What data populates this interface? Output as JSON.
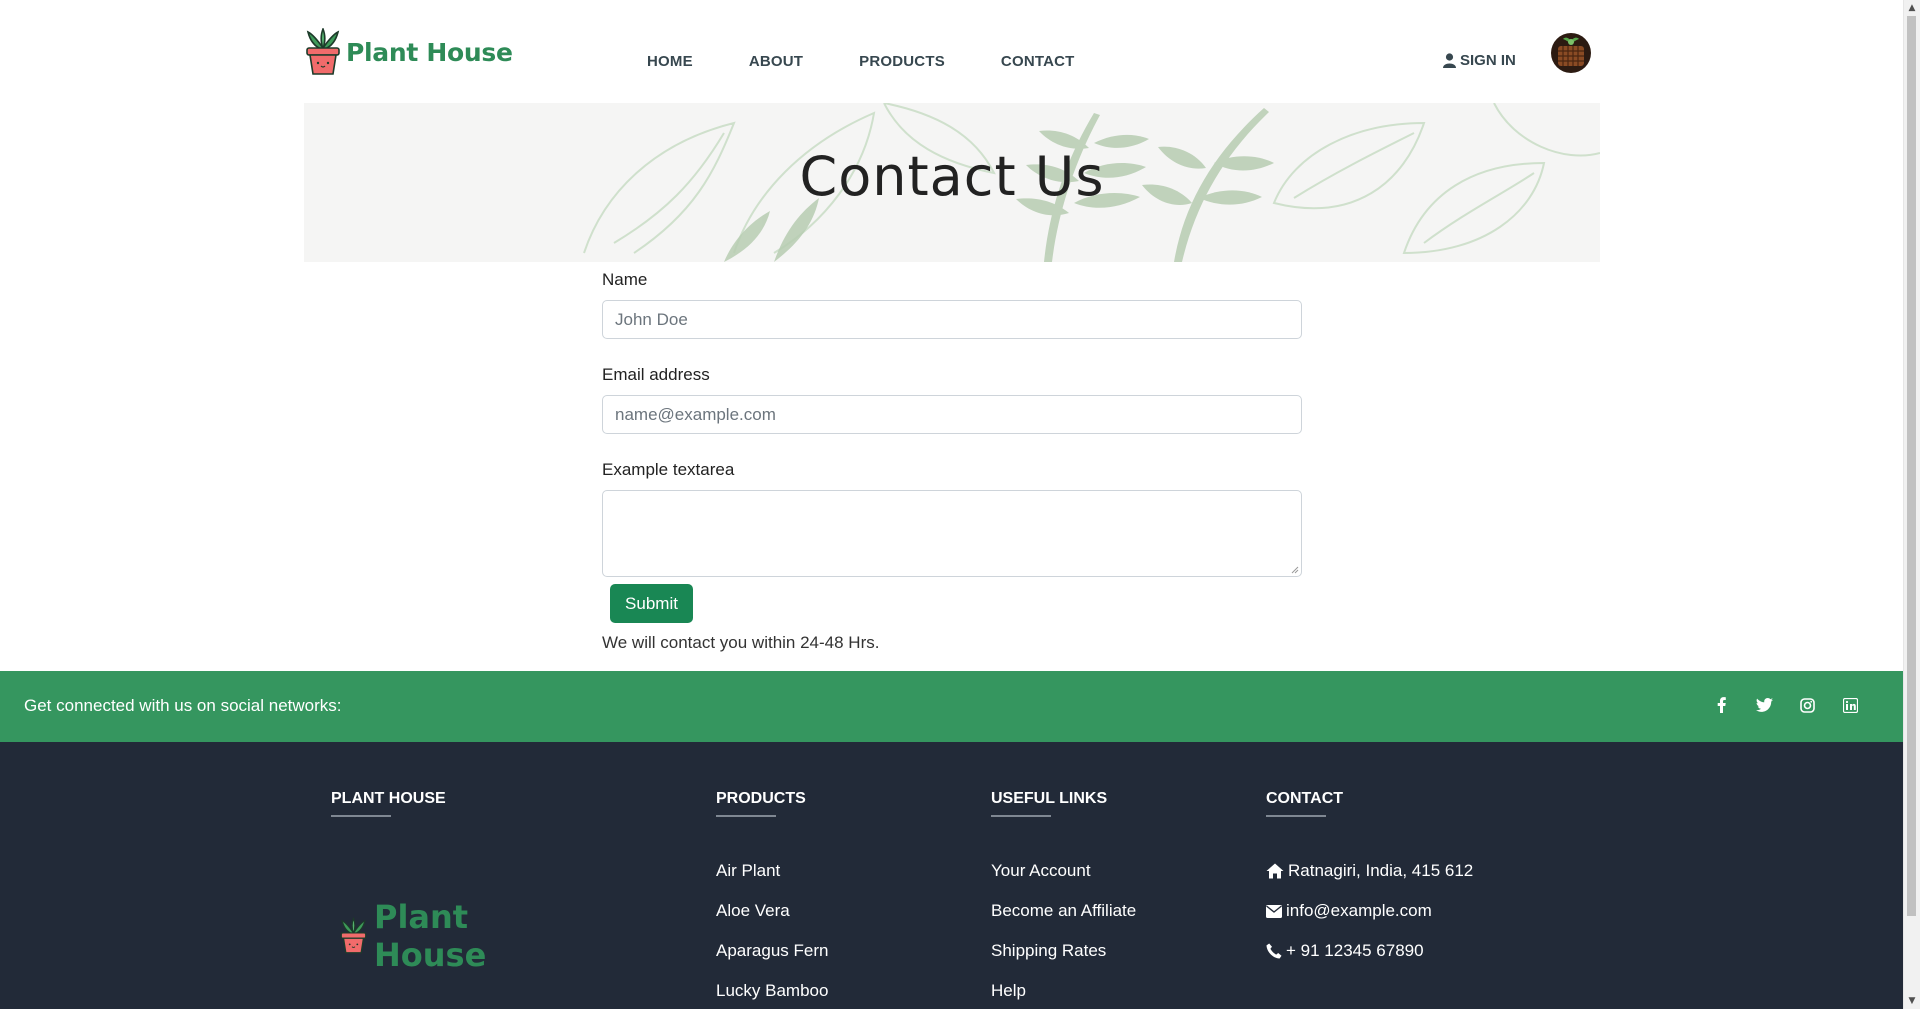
{
  "header": {
    "brand": "Plant House",
    "nav": [
      "HOME",
      "ABOUT",
      "PRODUCTS",
      "CONTACT"
    ],
    "signin": "SIGN IN"
  },
  "hero": {
    "title": "Contact Us"
  },
  "form": {
    "name_label": "Name",
    "name_placeholder": "John Doe",
    "email_label": "Email address",
    "email_placeholder": "name@example.com",
    "textarea_label": "Example textarea",
    "submit_label": "Submit",
    "note": "We will contact you within 24-48 Hrs."
  },
  "social": {
    "text": "Get connected with us on social networks:",
    "icons": [
      "facebook-icon",
      "twitter-icon",
      "instagram-icon",
      "linkedin-icon"
    ]
  },
  "footer": {
    "brand_heading": "PLANT HOUSE",
    "brand_logo_text": "Plant House",
    "products_heading": "PRODUCTS",
    "products": [
      "Air Plant",
      "Aloe Vera",
      "Aparagus Fern",
      "Lucky Bamboo"
    ],
    "links_heading": "USEFUL LINKS",
    "links": [
      "Your Account",
      "Become an Affiliate",
      "Shipping Rates",
      "Help"
    ],
    "contact_heading": "CONTACT",
    "address": "Ratnagiri, India, 415 612",
    "email": "info@example.com",
    "phone": "+ 91 12345 67890"
  },
  "colors": {
    "brand_green": "#2e8b57",
    "submit_green": "#198754",
    "social_bar": "#35965f",
    "footer_bg": "#222a38"
  }
}
